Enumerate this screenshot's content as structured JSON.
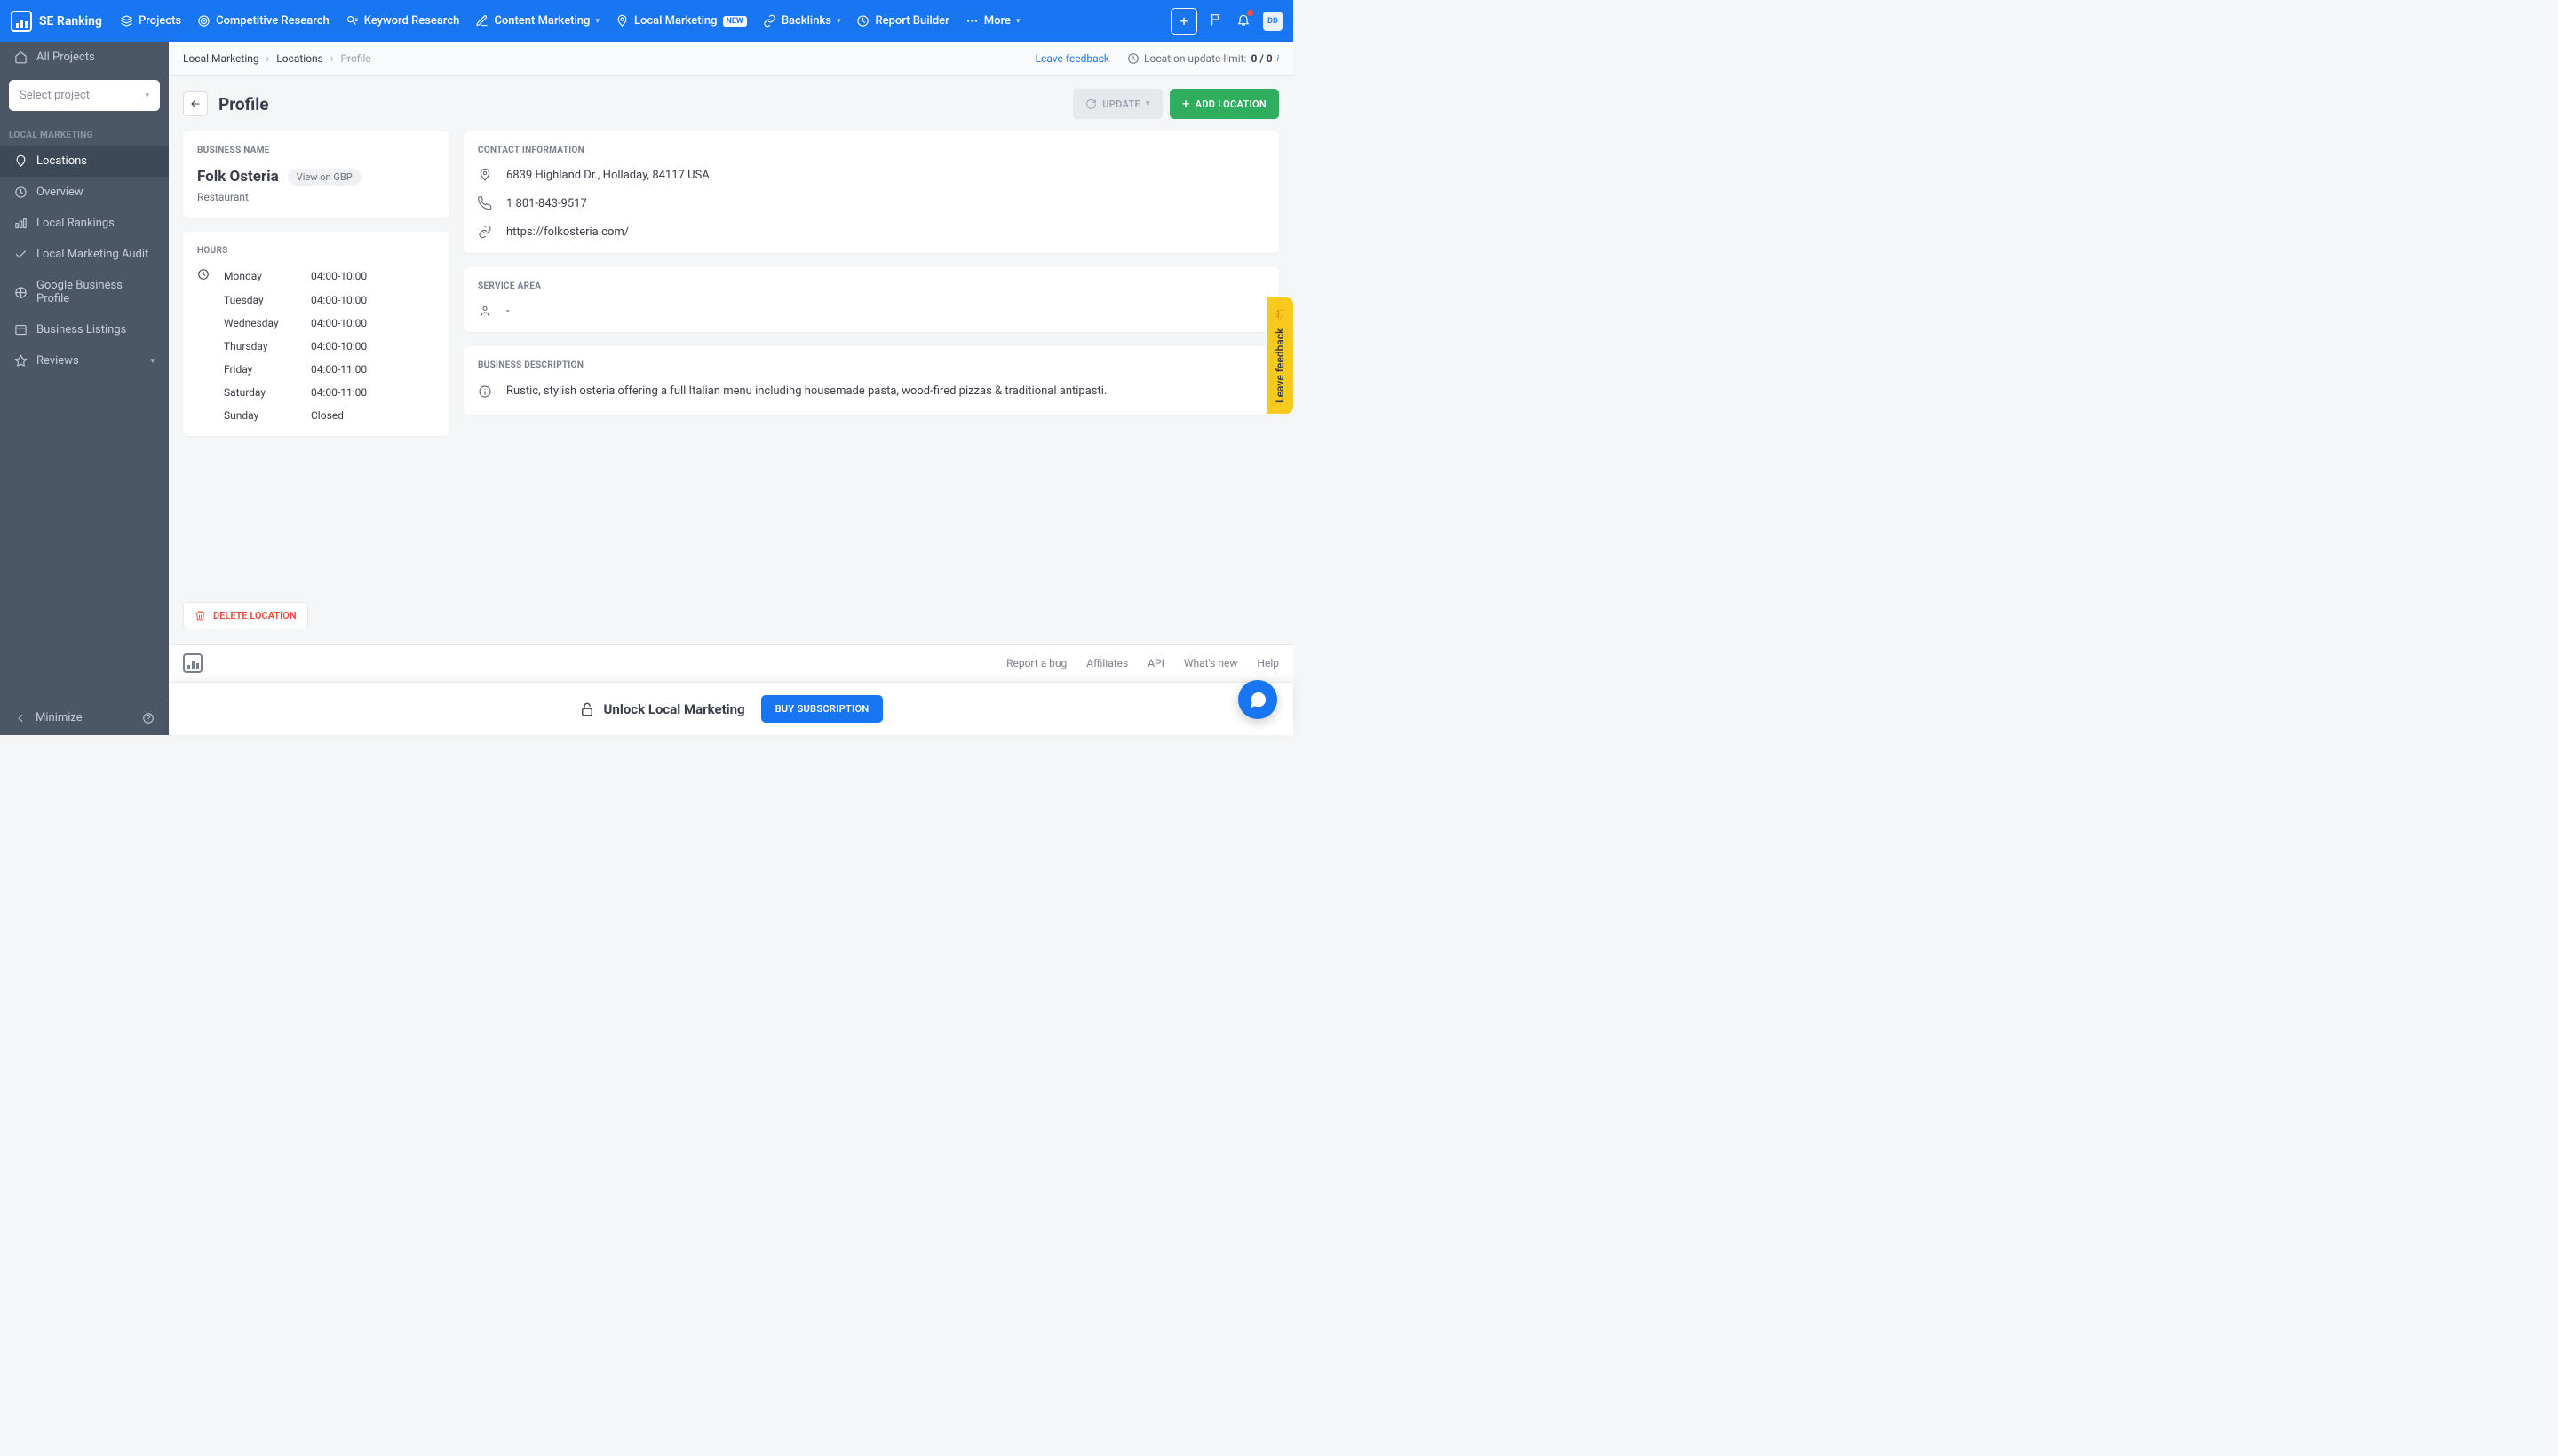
{
  "brand": "SE Ranking",
  "nav": {
    "projects": "Projects",
    "competitive": "Competitive Research",
    "keyword": "Keyword Research",
    "content": "Content Marketing",
    "local": "Local Marketing",
    "local_badge": "NEW",
    "backlinks": "Backlinks",
    "report": "Report Builder",
    "more": "More"
  },
  "avatar": "DD",
  "sidebar": {
    "all_projects": "All Projects",
    "select_placeholder": "Select project",
    "section": "LOCAL MARKETING",
    "items": {
      "locations": "Locations",
      "overview": "Overview",
      "rankings": "Local Rankings",
      "audit": "Local Marketing Audit",
      "gbp": "Google Business Profile",
      "listings": "Business Listings",
      "reviews": "Reviews"
    },
    "minimize": "Minimize"
  },
  "crumbs": {
    "a": "Local Marketing",
    "b": "Locations",
    "c": "Profile"
  },
  "leave_feedback": "Leave feedback",
  "limit_label": "Location update limit:",
  "limit_val": "0 / 0",
  "page_title": "Profile",
  "btn_update": "UPDATE",
  "btn_add": "ADD LOCATION",
  "labels": {
    "business_name": "BUSINESS NAME",
    "hours": "HOURS",
    "contact": "CONTACT INFORMATION",
    "service_area": "SERVICE AREA",
    "description": "BUSINESS DESCRIPTION"
  },
  "business": {
    "name": "Folk Osteria",
    "gbp": "View on GBP",
    "category": "Restaurant"
  },
  "hours": [
    {
      "day": "Monday",
      "time": "04:00-10:00"
    },
    {
      "day": "Tuesday",
      "time": "04:00-10:00"
    },
    {
      "day": "Wednesday",
      "time": "04:00-10:00"
    },
    {
      "day": "Thursday",
      "time": "04:00-10:00"
    },
    {
      "day": "Friday",
      "time": "04:00-11:00"
    },
    {
      "day": "Saturday",
      "time": "04:00-11:00"
    },
    {
      "day": "Sunday",
      "time": "Closed"
    }
  ],
  "contact": {
    "address": "6839 Highland Dr., Holladay, 84117 USA",
    "phone": "1 801-843-9517",
    "url": "https://folkosteria.com/"
  },
  "service_area": "-",
  "description": "Rustic, stylish osteria offering a full Italian menu including housemade pasta, wood-fired pizzas & traditional antipasti.",
  "delete": "DELETE LOCATION",
  "footer": {
    "bug": "Report a bug",
    "affiliates": "Affiliates",
    "api": "API",
    "whatsnew": "What's new",
    "help": "Help"
  },
  "unlock": "Unlock Local Marketing",
  "buy": "BUY SUBSCRIPTION",
  "side_fb": "Leave feedback"
}
